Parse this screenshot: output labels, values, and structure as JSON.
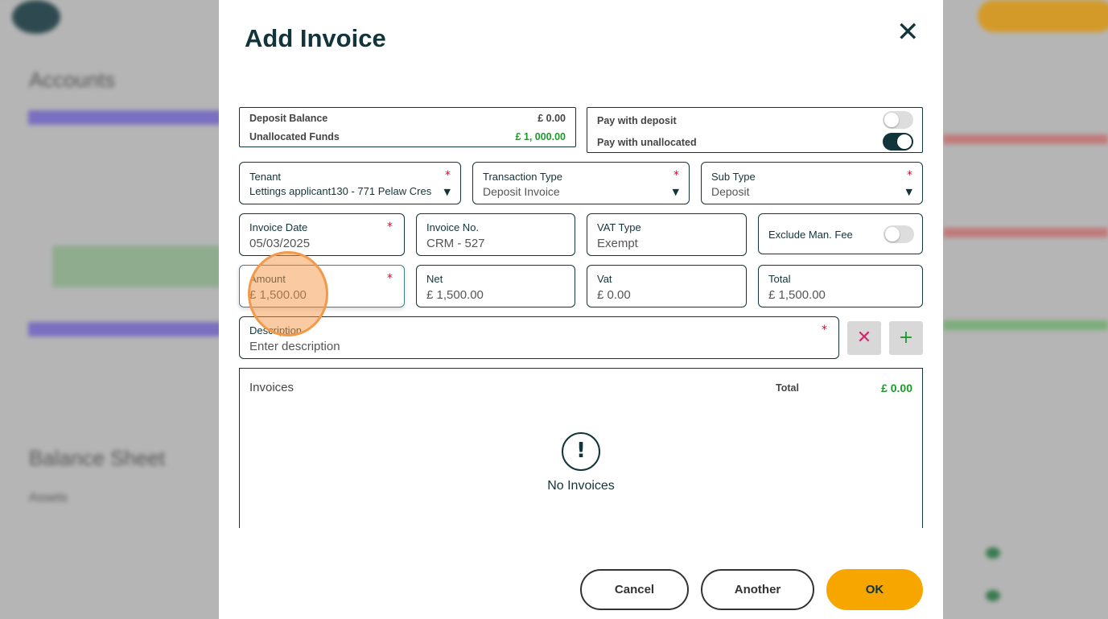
{
  "background": {
    "section1_title": "Accounts",
    "section2_title": "Balance Sheet",
    "assets_label": "Assets"
  },
  "modal": {
    "title": "Add Invoice",
    "close_icon": "close-icon",
    "balances": {
      "deposit_balance_label": "Deposit Balance",
      "deposit_balance_value": "£ 0.00",
      "unallocated_label": "Unallocated Funds",
      "unallocated_value": "£ 1, 000.00"
    },
    "pay_options": {
      "pay_with_deposit_label": "Pay with deposit",
      "pay_with_deposit_on": false,
      "pay_with_unallocated_label": "Pay with unallocated",
      "pay_with_unallocated_on": true
    },
    "tenant": {
      "label": "Tenant",
      "value": "Lettings applicant130 - 771 Pelaw Cres"
    },
    "transaction_type": {
      "label": "Transaction Type",
      "value": "Deposit Invoice"
    },
    "sub_type": {
      "label": "Sub Type",
      "value": "Deposit"
    },
    "invoice_date": {
      "label": "Invoice Date",
      "value": "05/03/2025"
    },
    "invoice_no": {
      "label": "Invoice No.",
      "value": "CRM - 527"
    },
    "vat_type": {
      "label": "VAT Type",
      "value": "Exempt"
    },
    "exclude_fee": {
      "label": "Exclude Man. Fee",
      "on": false
    },
    "amount": {
      "label": "Amount",
      "value": "£ 1,500.00"
    },
    "net": {
      "label": "Net",
      "value": "£ 1,500.00"
    },
    "vat": {
      "label": "Vat",
      "value": "£ 0.00"
    },
    "total": {
      "label": "Total",
      "value": "£ 1,500.00"
    },
    "description": {
      "label": "Description",
      "placeholder": "Enter description"
    },
    "invoices": {
      "title": "Invoices",
      "total_label": "Total",
      "total_value": "£ 0.00",
      "empty_text": "No Invoices"
    },
    "buttons": {
      "cancel": "Cancel",
      "another": "Another",
      "ok": "OK"
    },
    "colors": {
      "primary": "#12343b",
      "accent": "#f7a600",
      "positive": "#1a9c2a",
      "required": "#c8102e"
    }
  }
}
